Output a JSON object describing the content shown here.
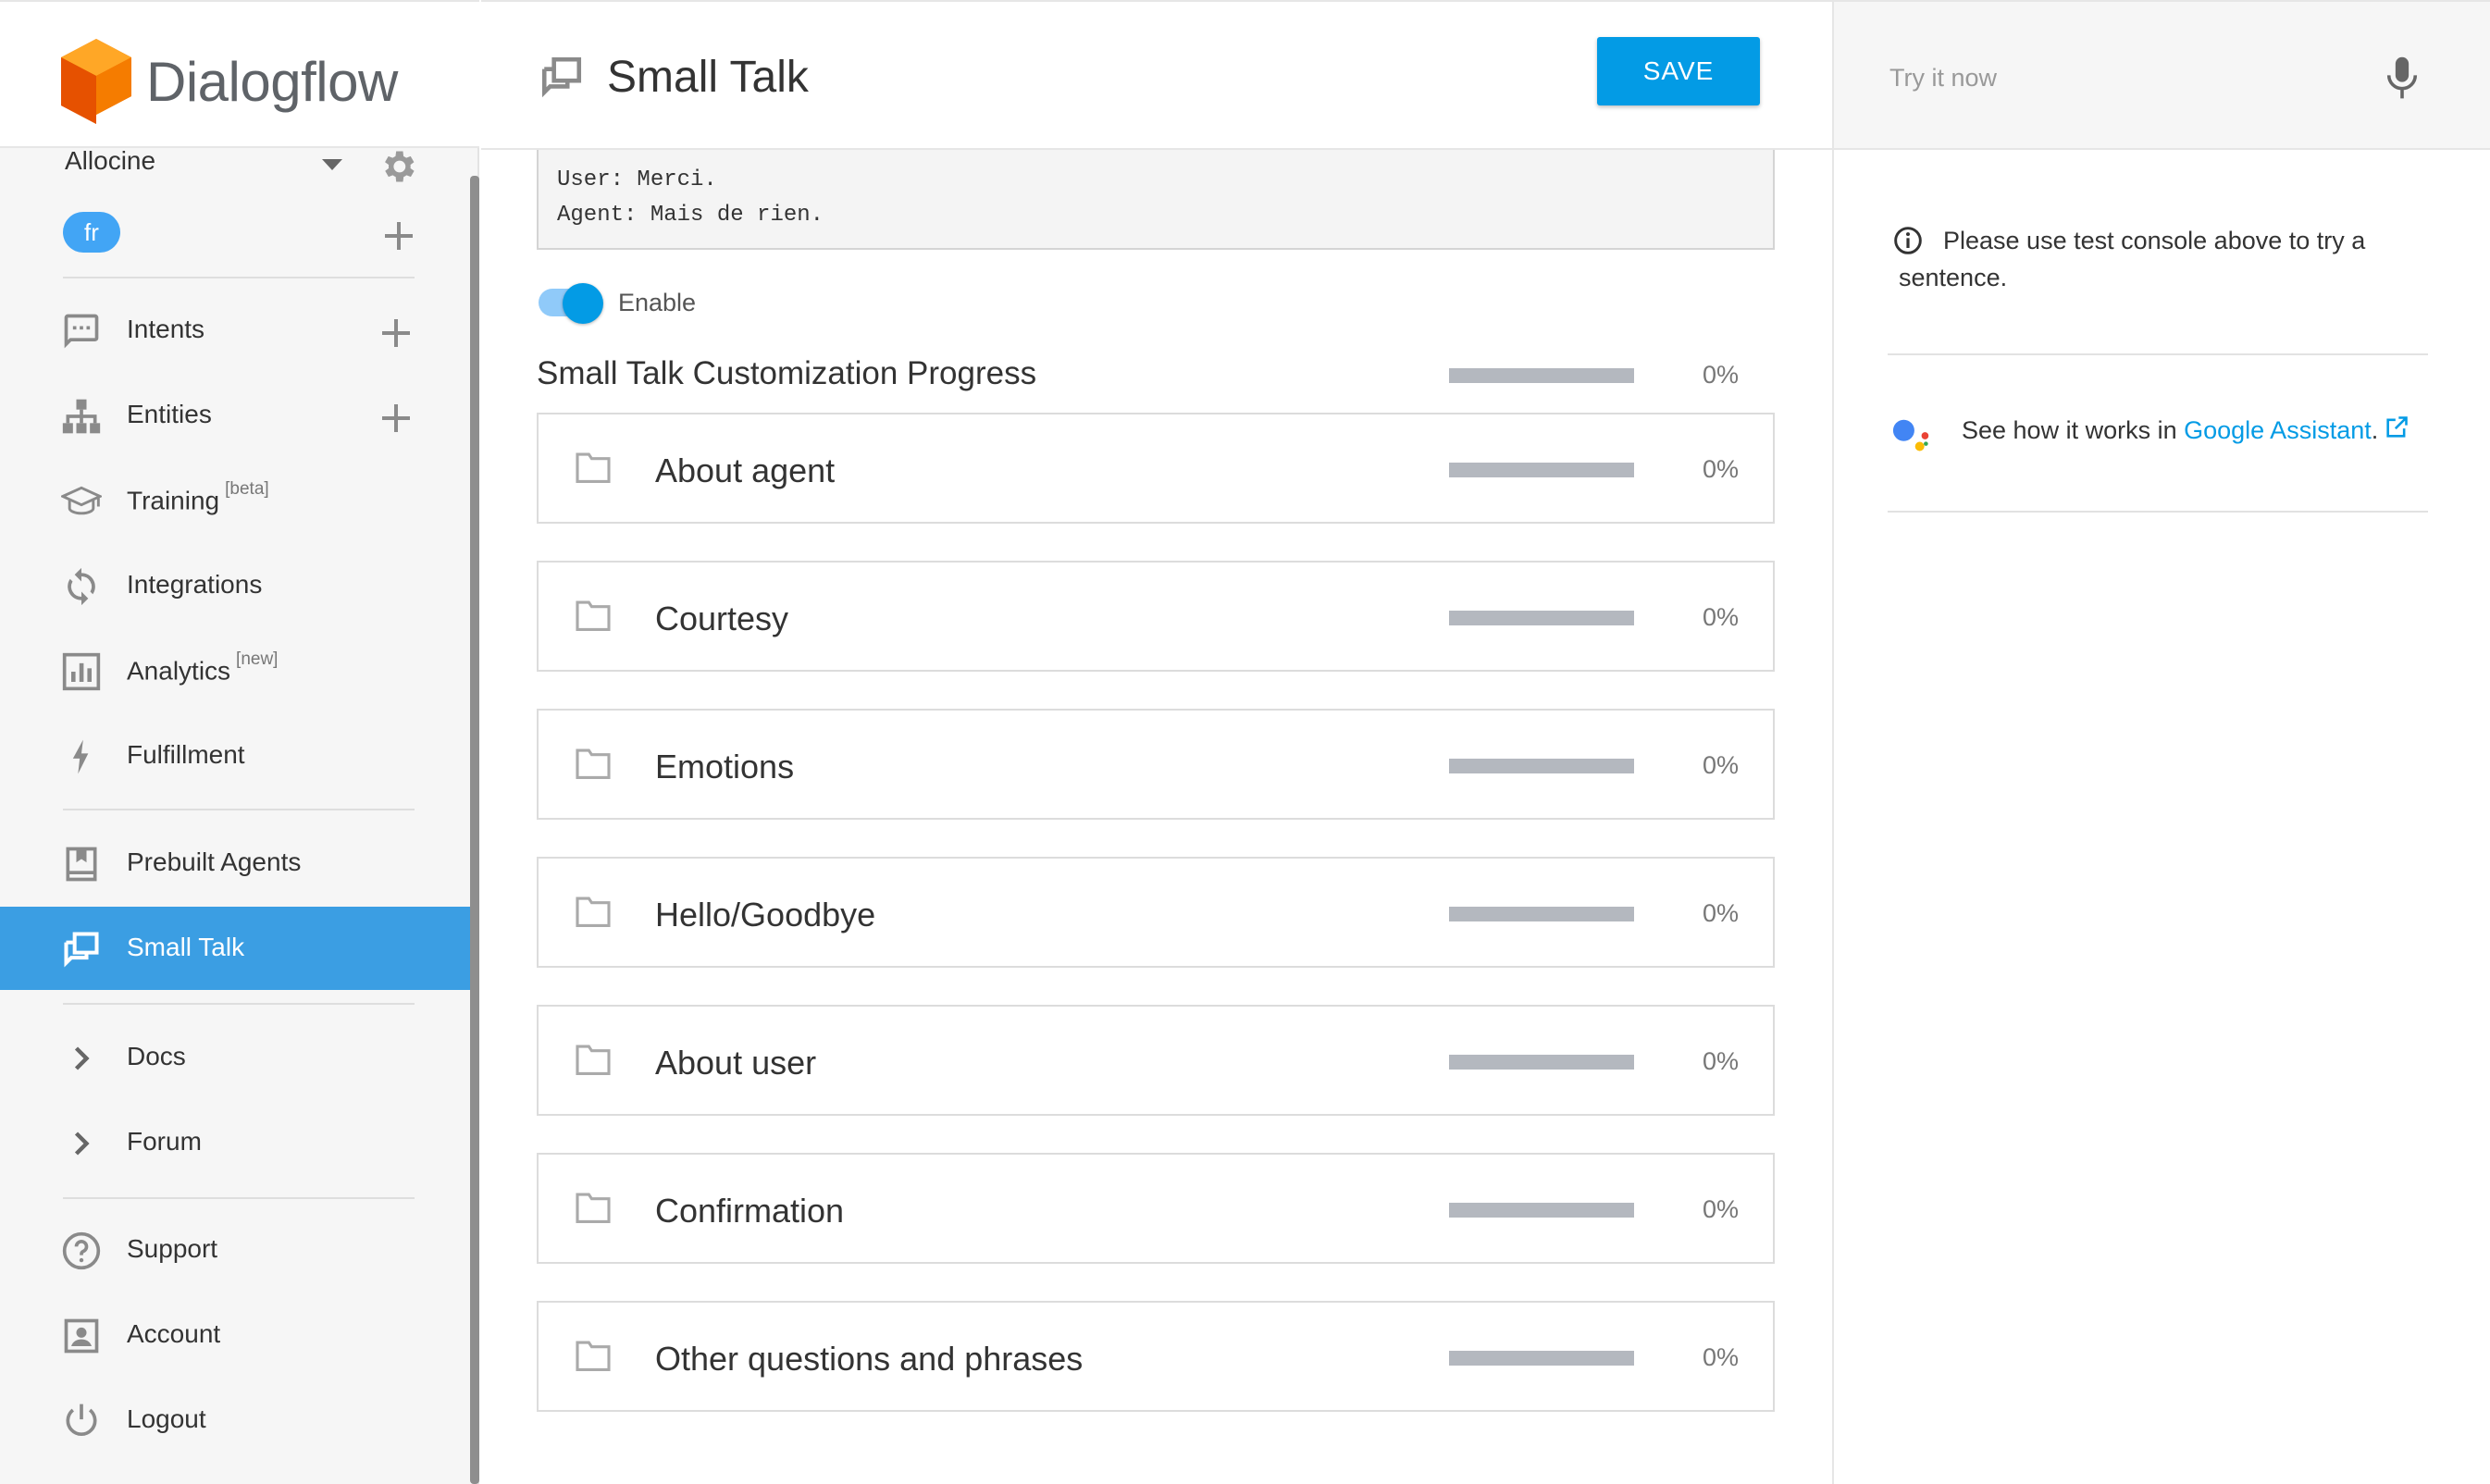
{
  "brand": {
    "name": "Dialogflow"
  },
  "agent": {
    "name": "Allocine",
    "language": "fr"
  },
  "sidebar": {
    "items": [
      {
        "label": "Intents",
        "sup": ""
      },
      {
        "label": "Entities",
        "sup": ""
      },
      {
        "label": "Training",
        "sup": "[beta]"
      },
      {
        "label": "Integrations",
        "sup": ""
      },
      {
        "label": "Analytics",
        "sup": "[new]"
      },
      {
        "label": "Fulfillment",
        "sup": ""
      },
      {
        "label": "Prebuilt Agents",
        "sup": ""
      },
      {
        "label": "Small Talk",
        "sup": "",
        "active": true
      },
      {
        "label": "Docs",
        "sup": ""
      },
      {
        "label": "Forum",
        "sup": ""
      },
      {
        "label": "Support",
        "sup": ""
      },
      {
        "label": "Account",
        "sup": ""
      },
      {
        "label": "Logout",
        "sup": ""
      }
    ]
  },
  "header": {
    "title": "Small Talk",
    "save_label": "SAVE"
  },
  "example": {
    "line1": "User: Merci.",
    "line2": "Agent: Mais de rien."
  },
  "toggle": {
    "label": "Enable",
    "on": true
  },
  "progress": {
    "title": "Small Talk Customization Progress",
    "percent_label": "0%",
    "fraction": 0
  },
  "categories": [
    {
      "name": "About agent",
      "percent_label": "0%",
      "fraction": 0
    },
    {
      "name": "Courtesy",
      "percent_label": "0%",
      "fraction": 0
    },
    {
      "name": "Emotions",
      "percent_label": "0%",
      "fraction": 0
    },
    {
      "name": "Hello/Goodbye",
      "percent_label": "0%",
      "fraction": 0
    },
    {
      "name": "About user",
      "percent_label": "0%",
      "fraction": 0
    },
    {
      "name": "Confirmation",
      "percent_label": "0%",
      "fraction": 0
    },
    {
      "name": "Other questions and phrases",
      "percent_label": "0%",
      "fraction": 0
    }
  ],
  "try_panel": {
    "placeholder": "Try it now",
    "info_text": "Please use test console above to try a sentence.",
    "ga_text": "See how it works in ",
    "ga_link": "Google Assistant",
    "ga_suffix": "."
  },
  "colors": {
    "accent": "#039be5",
    "active_nav": "#3b9ee3",
    "logo_orange": "#f57c00",
    "progress_track": "#b4b8bf"
  },
  "icons": {
    "intents": "chat-bubble-icon",
    "entities": "hierarchy-icon",
    "training": "graduation-cap-icon",
    "integrations": "sync-icon",
    "analytics": "bar-chart-icon",
    "fulfillment": "lightning-icon",
    "prebuilt": "book-icon",
    "small_talk": "chat-windows-icon",
    "docs": "chevron-right-icon",
    "forum": "chevron-right-icon",
    "support": "help-circle-icon",
    "account": "account-box-icon",
    "logout": "power-icon",
    "category": "folder-icon",
    "mic": "microphone-icon",
    "info": "info-icon",
    "assistant": "google-assistant-icon",
    "external": "external-link-icon"
  }
}
